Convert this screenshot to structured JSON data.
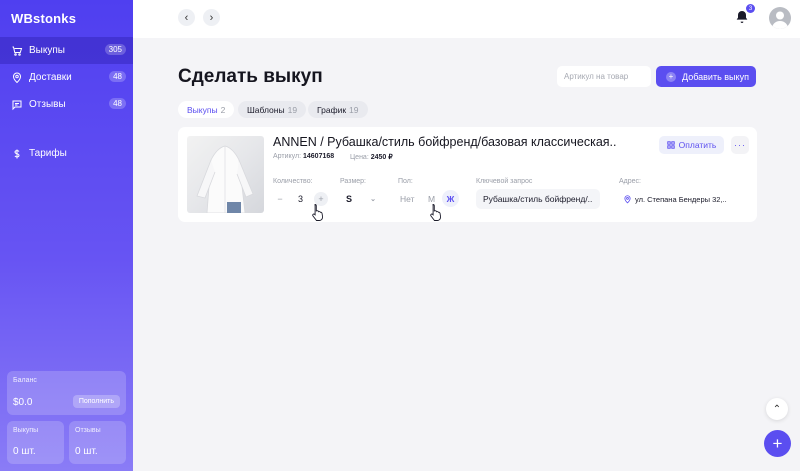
{
  "app": {
    "logo": "WBstonks"
  },
  "sidebar": {
    "items": [
      {
        "label": "Выкупы",
        "badge": "305",
        "icon": "cart-icon",
        "active": true
      },
      {
        "label": "Доставки",
        "badge": "48",
        "icon": "location-pin-icon",
        "active": false
      },
      {
        "label": "Отзывы",
        "badge": "48",
        "icon": "message-icon",
        "active": false
      },
      {
        "label": "Тарифы",
        "badge": "",
        "icon": "dollar-icon",
        "active": false
      }
    ],
    "balance": {
      "label": "Баланс",
      "value": "$0.0",
      "button": "Пополнить"
    },
    "purchases": {
      "label": "Выкупы",
      "value": "0 шт."
    },
    "reviews": {
      "label": "Отзывы",
      "value": "0 шт."
    }
  },
  "topbar": {
    "back_icon": "chevron-left-icon",
    "forward_icon": "chevron-right-icon",
    "notifications_count": "3"
  },
  "main": {
    "title": "Сделать выкуп",
    "article_placeholder": "Артикул на товар",
    "add_button": "Добавить выкуп",
    "tabs": [
      {
        "label": "Выкупы",
        "count": "2",
        "active": true
      },
      {
        "label": "Шаблоны",
        "count": "19",
        "active": false
      },
      {
        "label": "График",
        "count": "19",
        "active": false
      }
    ]
  },
  "product": {
    "title": "ANNEN / Рубашка/стиль бойфренд/базовая классическая..",
    "article_label": "Артикул:",
    "article_value": "14607168",
    "price_label": "Цена:",
    "price_value": "2450 ₽",
    "pay_button": "Оплатить",
    "more_label": "···",
    "quantity": {
      "label": "Количество:",
      "value": "3",
      "minus": "−",
      "plus": "+"
    },
    "size": {
      "label": "Размер:",
      "value": "S"
    },
    "gender": {
      "label": "Пол:",
      "options": [
        "Нет",
        "М",
        "Ж"
      ],
      "selected": "Ж"
    },
    "keyword": {
      "label": "Ключевой запрос",
      "value": "Рубашка/стиль бойфренд/.."
    },
    "address": {
      "label": "Адрес:",
      "value": "ул. Степана Бендеры 32,.."
    }
  },
  "colors": {
    "accent": "#5b4ef0",
    "sidebar_top": "#4f3ff0",
    "sidebar_bottom": "#8a7cf6"
  }
}
